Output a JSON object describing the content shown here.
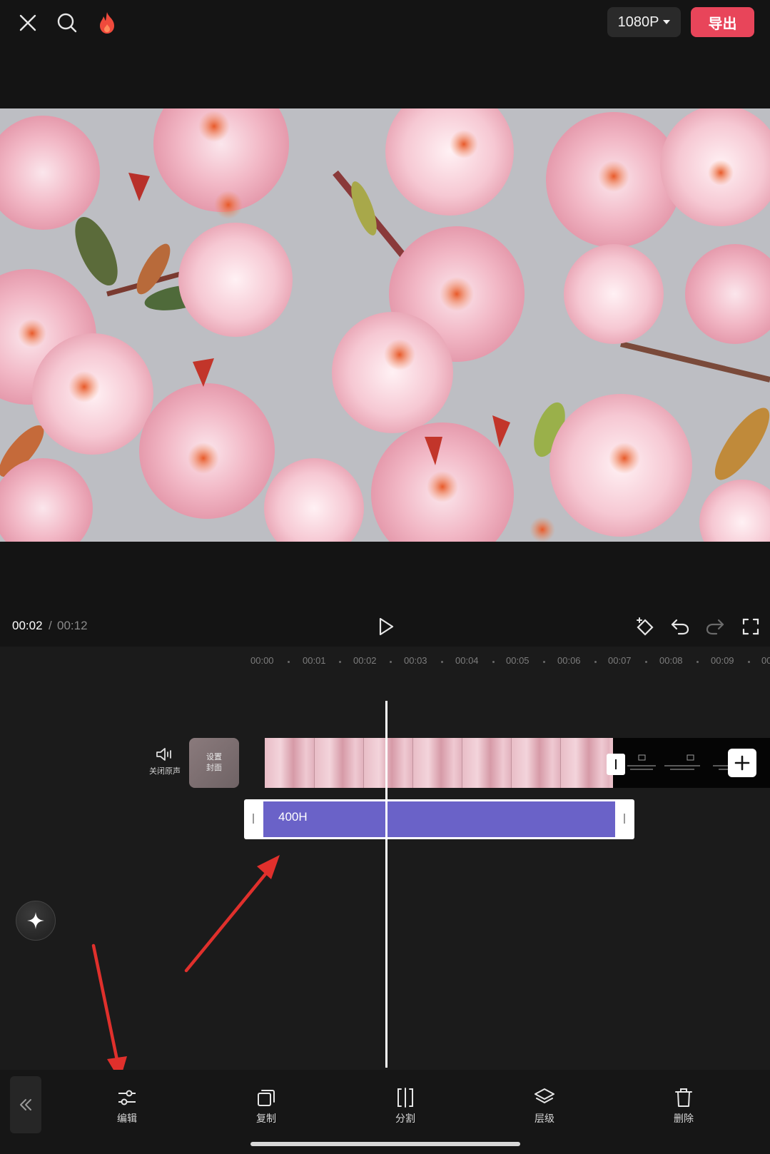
{
  "top_bar": {
    "close_icon": "close-icon",
    "search_icon": "search-icon",
    "hot_icon": "flame-icon",
    "resolution": "1080P",
    "export_label": "导出",
    "export_color": "#e8455a"
  },
  "preview": {
    "description_icon": "video-preview"
  },
  "playback": {
    "current_time": "00:02",
    "separator": "/",
    "total_time": "00:12"
  },
  "ruler": {
    "ticks": [
      "00:00",
      "00:01",
      "00:02",
      "00:03",
      "00:04",
      "00:05",
      "00:06",
      "00:07",
      "00:08",
      "00:09",
      "00"
    ]
  },
  "tracks": {
    "mute_label": "关闭原声",
    "cover_label": "设置封面",
    "text_clip_label": "400H",
    "text_clip_color": "#6a62c8"
  },
  "toolbar": {
    "items": [
      {
        "label": "编辑",
        "icon": "sliders-icon"
      },
      {
        "label": "复制",
        "icon": "copy-icon"
      },
      {
        "label": "分割",
        "icon": "split-icon"
      },
      {
        "label": "层级",
        "icon": "layers-icon"
      },
      {
        "label": "删除",
        "icon": "trash-icon"
      }
    ]
  }
}
